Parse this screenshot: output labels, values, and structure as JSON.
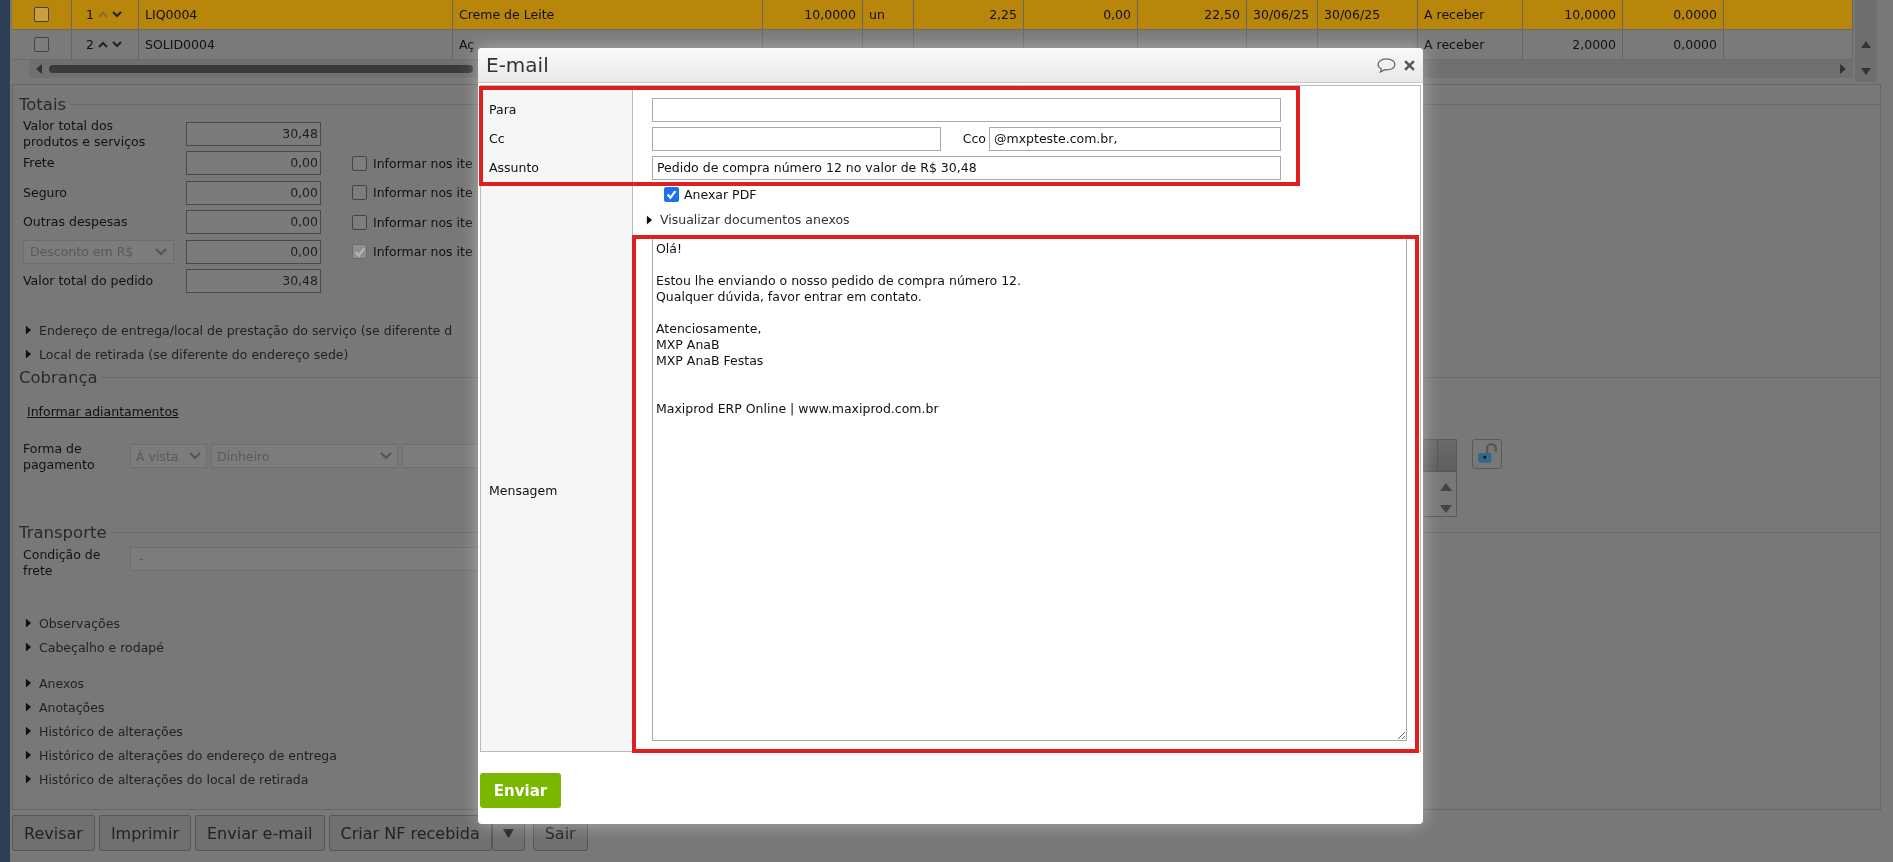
{
  "table": {
    "rows": [
      {
        "selected": true,
        "checked": false,
        "number": "1",
        "cells": [
          "LIQ0004",
          "Creme de Leite",
          "10,0000",
          "un",
          "2,25",
          "0,00",
          "22,50",
          "30/06/25",
          "30/06/25",
          "A receber",
          "10,0000",
          "0,0000"
        ]
      },
      {
        "selected": false,
        "checked": false,
        "number": "2",
        "cells": [
          "SOLID0004",
          "Aç",
          null,
          null,
          null,
          null,
          null,
          null,
          null,
          "A receber",
          "2,0000",
          "0,0000"
        ]
      }
    ]
  },
  "totals": {
    "title": "Totais",
    "rows": [
      {
        "kind": "amount",
        "label": "Valor total dos produtos e serviços",
        "value": "30,48"
      },
      {
        "kind": "amount",
        "label": "Frete",
        "value": "0,00",
        "option": {
          "label": "Informar nos ite",
          "checked": false,
          "disabled": false
        }
      },
      {
        "kind": "amount",
        "label": "Seguro",
        "value": "0,00",
        "option": {
          "label": "Informar nos ite",
          "checked": false,
          "disabled": false
        }
      },
      {
        "kind": "amount",
        "label": "Outras despesas",
        "value": "0,00",
        "option": {
          "label": "Informar nos ite",
          "checked": false,
          "disabled": false
        }
      },
      {
        "kind": "select",
        "label": "Desconto em R$",
        "value": "0,00",
        "option": {
          "label": "Informar nos ite",
          "checked": true,
          "disabled": true
        }
      },
      {
        "kind": "amount",
        "label": "Valor total do pedido",
        "value": "30,48"
      }
    ]
  },
  "sections_1": [
    {
      "label": "Endereço de entrega/local de prestação do serviço (se diferente d",
      "expanded": false
    },
    {
      "label": "Local de retirada (se diferente do endereço sede)",
      "expanded": false
    }
  ],
  "billing": {
    "title": "Cobrança",
    "link": "Informar adiantamentos",
    "payment_label": "Forma de pagamento",
    "selects": [
      "À vista",
      "Dinheiro"
    ]
  },
  "transport": {
    "title": "Transporte",
    "label": "Condição de frete",
    "value": "-"
  },
  "sections_2": [
    {
      "label": "Observações",
      "expanded": false
    },
    {
      "label": "Cabeçalho e rodapé",
      "expanded": false
    }
  ],
  "sections_3": [
    {
      "label": "Anexos",
      "expanded": false
    },
    {
      "label": "Anotações",
      "expanded": false
    },
    {
      "label": "Histórico de alterações",
      "expanded": false
    },
    {
      "label": "Histórico de alterações do endereço de entrega",
      "expanded": false
    },
    {
      "label": "Histórico de alterações do local de retirada",
      "expanded": false
    }
  ],
  "buttons": [
    {
      "label": "Revisar",
      "kind": "plain"
    },
    {
      "label": "Imprimir",
      "kind": "plain"
    },
    {
      "label": "Enviar e-mail",
      "kind": "plain"
    },
    {
      "label": "Criar NF recebida",
      "kind": "split"
    },
    {
      "label": "Sair",
      "kind": "plain"
    }
  ],
  "dialog": {
    "title": "E-mail",
    "header_fields": {
      "highlighted": true,
      "to": {
        "label": "Para"
      },
      "cc": {
        "label": "Cc"
      },
      "bcc": {
        "label": "Cco",
        "value": "@mxpteste.com.br,"
      },
      "subject": {
        "label": "Assunto",
        "value": "Pedido de compra número 12 no valor de R$ 30,48"
      }
    },
    "attach_pdf": {
      "label": "Anexar PDF",
      "checked": true
    },
    "attachments": {
      "label": "Visualizar documentos anexos",
      "expanded": false
    },
    "message": {
      "label": "Mensagem",
      "highlighted": true,
      "value": "Olá!\n\nEstou lhe enviando o nosso pedido de compra número 12.\nQualquer dúvida, favor entrar em contato.\n\nAtenciosamente,\nMXP AnaB\nMXP AnaB Festas\n\n\nMaxiprod ERP Online | www.maxiprod.com.br"
    },
    "send_button": "Enviar"
  }
}
